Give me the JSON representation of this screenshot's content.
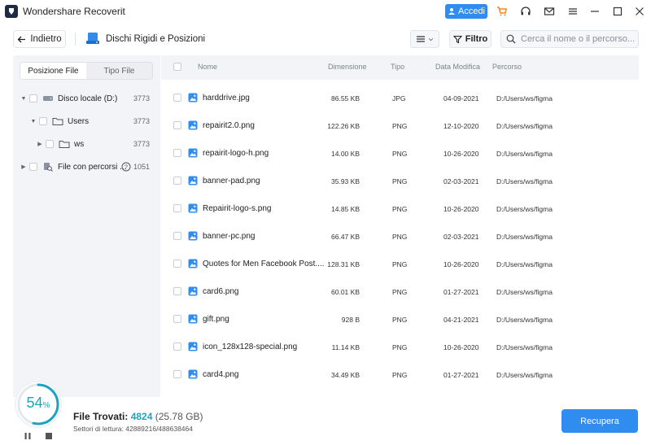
{
  "window": {
    "title": "Wondershare Recoverit",
    "login_label": "Accedi"
  },
  "toolbar": {
    "back_label": "Indietro",
    "page_title": "Dischi Rigidi e Posizioni",
    "filter_label": "Filtro",
    "search_placeholder": "Cerca il nome o il percorso..."
  },
  "sidebar": {
    "tabs": [
      {
        "label": "Posizione File",
        "active": true
      },
      {
        "label": "Tipo File",
        "active": false
      }
    ],
    "tree": [
      {
        "label": "Disco locale (D:)",
        "count": "3773",
        "icon": "disk-icon"
      },
      {
        "label": "Users",
        "count": "3773",
        "icon": "folder-icon"
      },
      {
        "label": "ws",
        "count": "3773",
        "icon": "folder-icon"
      },
      {
        "label": "File con percorsi ...",
        "count": "1051",
        "icon": "file-search-icon"
      }
    ]
  },
  "table": {
    "columns": [
      "Nome",
      "Dimensione",
      "Tipo",
      "Data Modifica",
      "Percorso"
    ],
    "rows": [
      {
        "name": "harddrive.jpg",
        "size": "86.55 KB",
        "type": "JPG",
        "date": "04-09-2021",
        "path": "D:/Users/ws/figma"
      },
      {
        "name": "repairit2.0.png",
        "size": "122.26 KB",
        "type": "PNG",
        "date": "12-10-2020",
        "path": "D:/Users/ws/figma"
      },
      {
        "name": "repairit-logo-h.png",
        "size": "14.00 KB",
        "type": "PNG",
        "date": "10-26-2020",
        "path": "D:/Users/ws/figma"
      },
      {
        "name": "banner-pad.png",
        "size": "35.93 KB",
        "type": "PNG",
        "date": "02-03-2021",
        "path": "D:/Users/ws/figma"
      },
      {
        "name": "Repairit-logo-s.png",
        "size": "14.85 KB",
        "type": "PNG",
        "date": "10-26-2020",
        "path": "D:/Users/ws/figma"
      },
      {
        "name": "banner-pc.png",
        "size": "66.47 KB",
        "type": "PNG",
        "date": "02-03-2021",
        "path": "D:/Users/ws/figma"
      },
      {
        "name": "Quotes for Men Facebook Post....",
        "size": "128.31 KB",
        "type": "PNG",
        "date": "10-26-2020",
        "path": "D:/Users/ws/figma"
      },
      {
        "name": "card6.png",
        "size": "60.01 KB",
        "type": "PNG",
        "date": "01-27-2021",
        "path": "D:/Users/ws/figma"
      },
      {
        "name": "gift.png",
        "size": "928 B",
        "type": "PNG",
        "date": "04-21-2021",
        "path": "D:/Users/ws/figma"
      },
      {
        "name": "icon_128x128-special.png",
        "size": "11.14 KB",
        "type": "PNG",
        "date": "10-26-2020",
        "path": "D:/Users/ws/figma"
      },
      {
        "name": "card4.png",
        "size": "34.49 KB",
        "type": "PNG",
        "date": "01-27-2021",
        "path": "D:/Users/ws/figma"
      }
    ]
  },
  "status": {
    "progress_value": 54,
    "progress_number": "54",
    "progress_unit": "%",
    "found_label": "File Trovati:",
    "found_count": "4824",
    "found_size": "(25.78 GB)",
    "sectors": "Settori di lettura: 42889216/488638464",
    "recover_label": "Recupera"
  },
  "colors": {
    "accent": "#2f8df0",
    "progress": "#1aa3c2",
    "panel_bg": "#f3f4f7"
  }
}
